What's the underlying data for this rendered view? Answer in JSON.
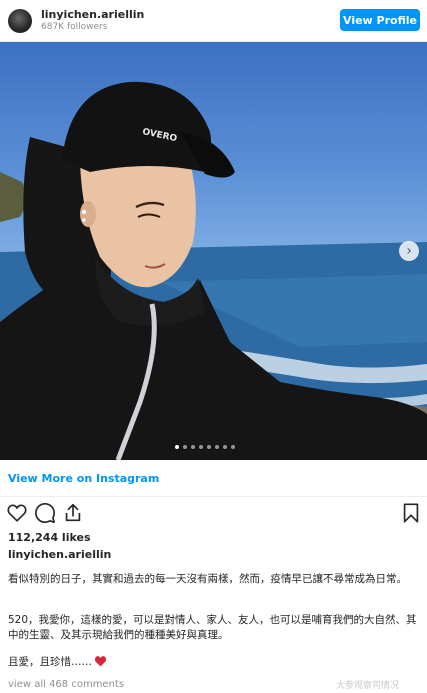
{
  "header": {
    "username": "linyichen.ariellin",
    "followers": "687K followers",
    "view_profile_label": "View Profile"
  },
  "carousel": {
    "slide_count": 8,
    "active_index": 1
  },
  "view_more_label": "View More on Instagram",
  "likes": "112,244 likes",
  "caption": {
    "username": "linyichen.ariellin",
    "line1": "看似特別的日子，其實和過去的每一天沒有兩樣，然而，疫情早已讓不尋常成為日常。",
    "line2": "520，我愛你，這樣的愛，可以是對情人、家人、友人，也可以是哺育我們的大自然、其中的生靈、及其示現給我們的種種美好與真理。",
    "line3": "且愛，且珍惜……"
  },
  "comments": "view all 468 comments",
  "watermark": "大参观察司情况",
  "colors": {
    "accent": "#0095f6",
    "heart": "#d6283a",
    "text": "#262626",
    "muted": "#8e8e8e"
  }
}
